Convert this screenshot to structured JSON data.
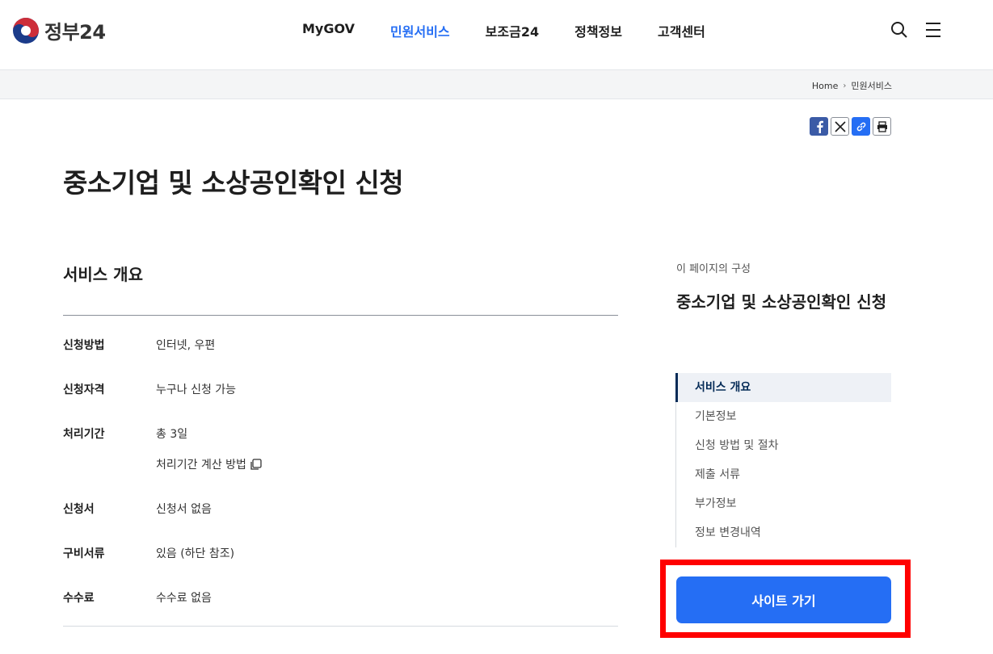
{
  "header": {
    "logo_text": "정부24",
    "nav": [
      "MyGOV",
      "민원서비스",
      "보조금24",
      "정책정보",
      "고객센터"
    ],
    "active_nav": "민원서비스",
    "icons": [
      "search-icon",
      "menu-icon"
    ]
  },
  "breadcrumb": {
    "home": "Home",
    "current": "민원서비스"
  },
  "share": [
    "facebook-icon",
    "x-icon",
    "link-icon",
    "print-icon"
  ],
  "page": {
    "title": "중소기업 및 소상공인확인 신청"
  },
  "overview": {
    "title": "서비스 개요",
    "rows": [
      {
        "label": "신청방법",
        "value": "인터넷, 우편"
      },
      {
        "label": "신청자격",
        "value": "누구나 신청 가능"
      },
      {
        "label": "처리기간",
        "value": "총 3일",
        "link": "처리기간 계산 방법"
      },
      {
        "label": "신청서",
        "value": "신청서 없음"
      },
      {
        "label": "구비서류",
        "value": "있음 (하단 참조)"
      },
      {
        "label": "수수료",
        "value": "수수료 없음"
      }
    ]
  },
  "toc": {
    "caption": "이 페이지의 구성",
    "title": "중소기업 및 소상공인확인 신청",
    "items": [
      "서비스 개요",
      "기본정보",
      "신청 방법 및 절차",
      "제출 서류",
      "부가정보",
      "정보 변경내역"
    ],
    "active": "서비스 개요"
  },
  "site_button": {
    "label": "사이트 가기"
  },
  "colors": {
    "primary": "#256ef4",
    "highlight_frame": "#ff0000",
    "toc_active": "#052b57"
  }
}
